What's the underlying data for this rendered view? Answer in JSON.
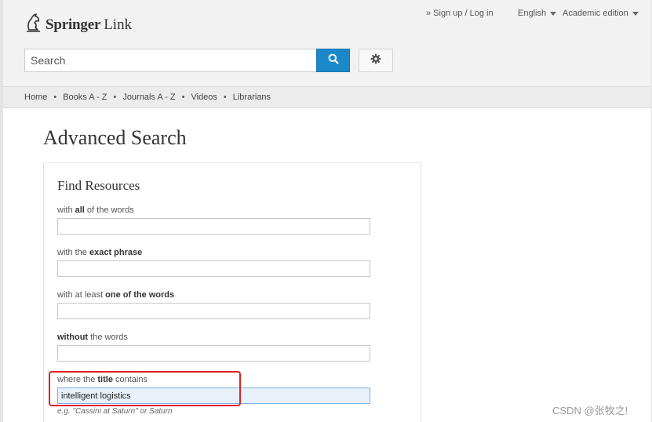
{
  "brand": {
    "name_bold": "Springer",
    "name_light": "Link"
  },
  "header": {
    "signup": "» Sign up / Log in",
    "language": "English",
    "edition": "Academic edition"
  },
  "search": {
    "placeholder": "Search"
  },
  "nav": {
    "items": [
      "Home",
      "Books A - Z",
      "Journals A - Z",
      "Videos",
      "Librarians"
    ],
    "separator": "•"
  },
  "page": {
    "title": "Advanced Search"
  },
  "panel": {
    "title": "Find Resources",
    "fields": [
      {
        "pre": "with ",
        "bold": "all",
        "post": " of the words",
        "value": ""
      },
      {
        "pre": "with the ",
        "bold": "exact phrase",
        "post": "",
        "value": ""
      },
      {
        "pre": "with at least ",
        "bold": "one of the words",
        "post": "",
        "value": ""
      },
      {
        "pre": "",
        "bold": "without",
        "post": " the words",
        "value": ""
      },
      {
        "pre": "where the ",
        "bold": "title",
        "post": " contains",
        "value": "intelligent logistics"
      }
    ],
    "title_hint": "e.g. \"Cassini at Saturn\" or Saturn"
  },
  "watermark": "CSDN @张牧之!",
  "colors": {
    "accent": "#1a88c9",
    "highlight": "#e02222"
  },
  "icons": {
    "search": "search-icon",
    "settings": "gear-icon",
    "dropdown": "chevron-down-icon",
    "logo": "springer-horse-icon"
  }
}
